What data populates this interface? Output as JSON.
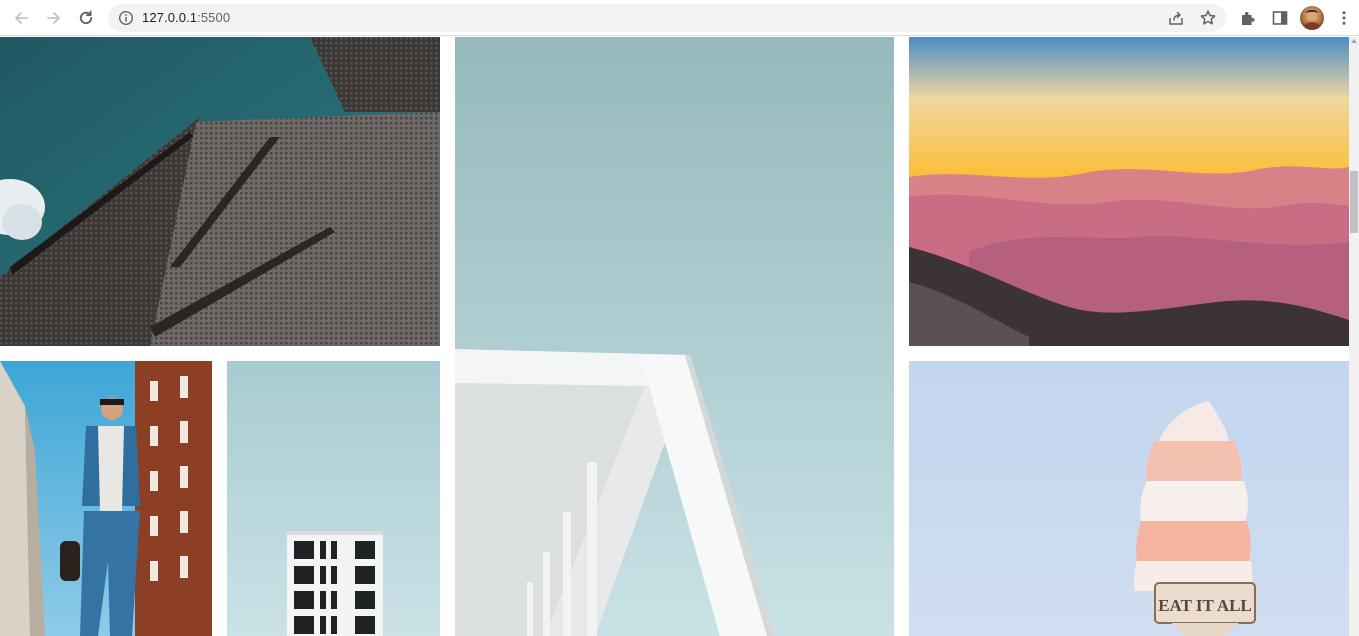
{
  "browser": {
    "url_host": "127.0.0.1",
    "url_port": ":5500",
    "icons": {
      "back": "back-arrow-icon",
      "forward": "forward-arrow-icon",
      "reload": "reload-icon",
      "info": "info-icon",
      "share": "share-icon",
      "bookmark": "star-icon",
      "extensions": "puzzle-icon",
      "side_panel": "side-panel-icon",
      "profile": "avatar",
      "menu": "kebab-menu-icon"
    }
  },
  "gallery": {
    "images": [
      {
        "subject": "architecture-dark-building"
      },
      {
        "subject": "white-building-blue-sky"
      },
      {
        "subject": "sunset-mountains"
      },
      {
        "subject": "man-walking-street"
      },
      {
        "subject": "white-tower-windows"
      },
      {
        "subject": "ice-cream-sign",
        "sign_text": "EAT IT ALL"
      }
    ]
  },
  "colors": {
    "toolbar_bg": "#ffffff",
    "omnibox_bg": "#f1f3f4",
    "icon": "#5f6368",
    "scrollbar_track": "#f1f1f1",
    "scrollbar_thumb": "#c1c1c1"
  }
}
